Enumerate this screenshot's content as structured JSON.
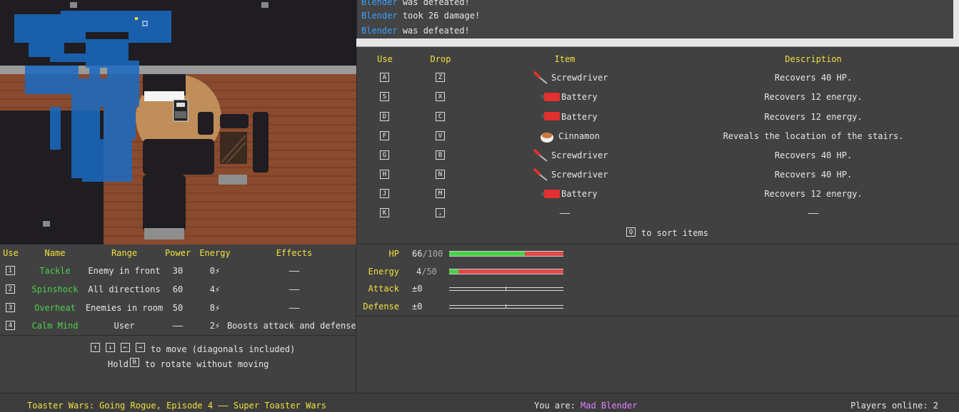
{
  "log": {
    "lines": [
      {
        "who": "Blender",
        "text": "was defeated!"
      },
      {
        "who": "Blender",
        "text": "took 26 damage!"
      },
      {
        "who": "Blender",
        "text": "was defeated!"
      }
    ]
  },
  "items": {
    "headers": {
      "use": "Use",
      "drop": "Drop",
      "item": "Item",
      "description": "Description"
    },
    "rows": [
      {
        "use_key": "A",
        "drop_key": "Z",
        "icon": "screwdriver-icon",
        "name": "Screwdriver",
        "desc": "Recovers 40 HP."
      },
      {
        "use_key": "S",
        "drop_key": "X",
        "icon": "battery-icon",
        "name": "Battery",
        "desc": "Recovers 12 energy."
      },
      {
        "use_key": "D",
        "drop_key": "C",
        "icon": "battery-icon",
        "name": "Battery",
        "desc": "Recovers 12 energy."
      },
      {
        "use_key": "F",
        "drop_key": "V",
        "icon": "cinnamon-icon",
        "name": "Cinnamon",
        "desc": "Reveals the location of the stairs."
      },
      {
        "use_key": "G",
        "drop_key": "B",
        "icon": "screwdriver-icon",
        "name": "Screwdriver",
        "desc": "Recovers 40 HP."
      },
      {
        "use_key": "H",
        "drop_key": "N",
        "icon": "screwdriver-icon",
        "name": "Screwdriver",
        "desc": "Recovers 40 HP."
      },
      {
        "use_key": "J",
        "drop_key": "M",
        "icon": "battery-icon",
        "name": "Battery",
        "desc": "Recovers 12 energy."
      },
      {
        "use_key": "K",
        "drop_key": ",",
        "icon": "",
        "name": "——",
        "desc": "——"
      }
    ],
    "sort_key": "Q",
    "sort_text": "to sort items"
  },
  "moves": {
    "headers": {
      "use": "Use",
      "name": "Name",
      "range": "Range",
      "power": "Power",
      "energy": "Energy",
      "effects": "Effects"
    },
    "rows": [
      {
        "key": "1",
        "name": "Tackle",
        "range": "Enemy in front",
        "power": "30",
        "energy": "0⚡",
        "effects": "——"
      },
      {
        "key": "2",
        "name": "Spinshock",
        "range": "All directions",
        "power": "60",
        "energy": "4⚡",
        "effects": "——"
      },
      {
        "key": "3",
        "name": "Overheat",
        "range": "Enemies in room",
        "power": "50",
        "energy": "8⚡",
        "effects": "——"
      },
      {
        "key": "4",
        "name": "Calm Mind",
        "range": "User",
        "power": "——",
        "energy": "2⚡",
        "effects": "Boosts attack and defense."
      }
    ],
    "help": {
      "keys1": [
        "↑",
        "↓",
        "←",
        "→"
      ],
      "text1": "to move (diagonals included)",
      "prefix2": "Hold",
      "key2": "R",
      "text2": "to rotate without moving"
    }
  },
  "stats": {
    "hp": {
      "label": "HP",
      "current": "66",
      "max": "/100",
      "fraction": 0.66
    },
    "energy": {
      "label": "Energy",
      "current": "4",
      "max": "/50",
      "fraction": 0.08
    },
    "attack": {
      "label": "Attack",
      "value": "±0"
    },
    "defense": {
      "label": "Defense",
      "value": "±0"
    }
  },
  "footer": {
    "title": "Toaster Wars: Going Rogue, Episode 4 —— Super Toaster Wars",
    "you_are_label": "You are:",
    "player_name": "Mad Blender",
    "players_online": "Players online: 2"
  },
  "colors": {
    "accent_yellow": "#f0e040",
    "move_green": "#4ccf4c",
    "log_blue": "#3aa0ff",
    "player_pink": "#e080ff",
    "hp_green": "#4ccf4c",
    "hp_red": "#e04a4a"
  }
}
